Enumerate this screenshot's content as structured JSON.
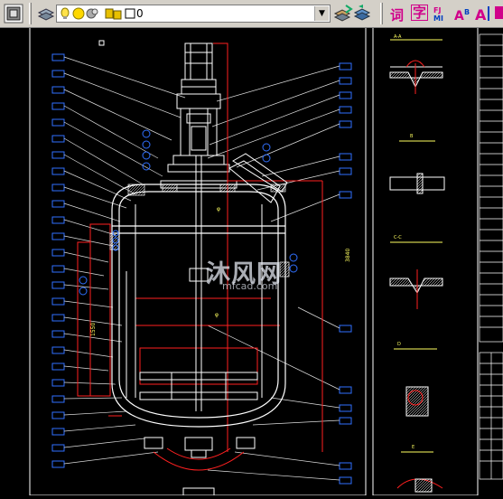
{
  "toolbar": {
    "layer_value": "0",
    "text_tool_label": "词",
    "mtext_label": "字",
    "colors": {
      "bg": "#d4d0c8",
      "pink": "#d0008a",
      "blue": "#0040c0"
    }
  },
  "drawing": {
    "background": "#000000",
    "watermark": "沐风网",
    "watermark_url": "mfcad.com"
  }
}
